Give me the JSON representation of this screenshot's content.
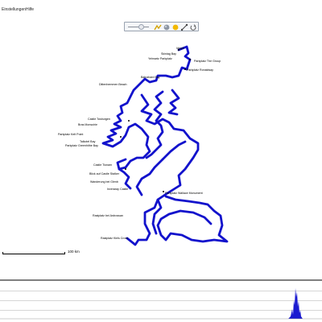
{
  "menu": {
    "settings": "Einstellungen",
    "help": "Hilfe"
  },
  "toolbar": {
    "tools": [
      "zoom-slider",
      "route-icon",
      "globe-icon",
      "sun-icon",
      "waypoint-icon",
      "reload-icon"
    ]
  },
  "map": {
    "route_color": "#1212cc",
    "labels": [
      "Idrigill",
      "Skiniag Bay",
      "Yelmartz Parkplatz",
      "Parkplatz The Group",
      "Parkplatz Ronaldsay",
      "Balnahard Bay",
      "Dittenhemmen Beach",
      "Castle Tosburgen",
      "Bras Monsoirie",
      "Parkplatz Kelt Point",
      "Talkotel Bay",
      "Parkplatz Greenhithe Bay",
      "Castle Tionam",
      "Blick auf Castle Stalker",
      "Wanderung bei Glenb",
      "Inveraray Castle",
      "Parkplatz Wallace Monument",
      "Rastplatz bei Ardrossan",
      "Rastplatz Kiels Cross"
    ]
  },
  "scalebar": {
    "label": "100 km"
  },
  "colors": {
    "route": "#1212cc",
    "panel_border": "#7f7f7f",
    "elevation": "#1a1ad0"
  }
}
